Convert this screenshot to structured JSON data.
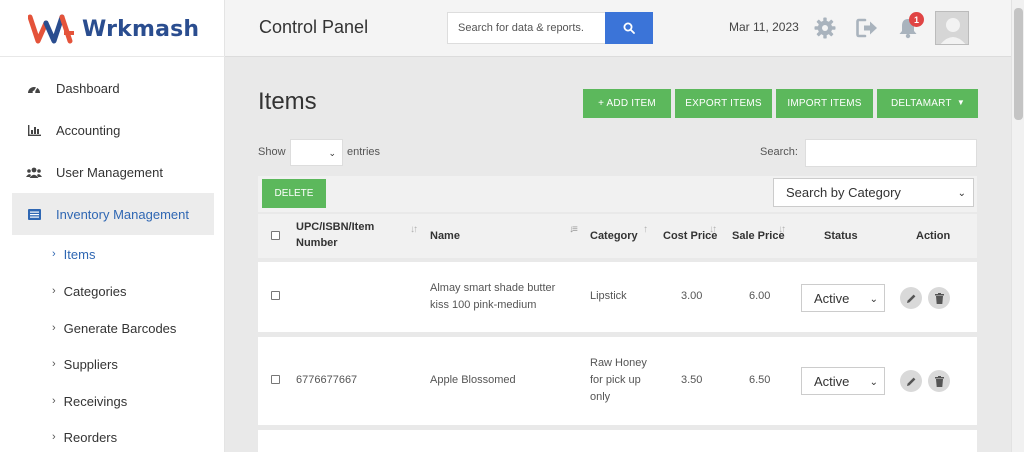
{
  "brand": {
    "name": "Wrkmash"
  },
  "sidebar": {
    "items": [
      {
        "label": "Dashboard",
        "icon": "dashboard-gauge-icon"
      },
      {
        "label": "Accounting",
        "icon": "bar-chart-icon"
      },
      {
        "label": "User Management",
        "icon": "users-icon"
      },
      {
        "label": "Inventory Management",
        "icon": "list-icon",
        "active": true
      }
    ],
    "subitems": [
      {
        "label": "Items",
        "active": true
      },
      {
        "label": "Categories"
      },
      {
        "label": "Generate Barcodes"
      },
      {
        "label": "Suppliers"
      },
      {
        "label": "Receivings"
      },
      {
        "label": "Reorders"
      }
    ]
  },
  "topbar": {
    "title": "Control Panel",
    "search_placeholder": "Search for data & reports.",
    "date": "Mar 11, 2023",
    "notification_count": "1"
  },
  "main": {
    "title": "Items",
    "buttons": {
      "add_item": "+ ADD ITEM",
      "export_items": "EXPORT ITEMS",
      "import_items": "IMPORT ITEMS",
      "store": "DELTAMART"
    },
    "show_label": "Show",
    "entries_label": "entries",
    "search_label": "Search:",
    "delete_label": "DELETE",
    "category_select": "Search by Category"
  },
  "table": {
    "headers": {
      "upc_line1": "UPC/ISBN/Item",
      "upc_line2": "Number",
      "name": "Name",
      "category": "Category",
      "cost_price": "Cost Price",
      "sale_price": "Sale Price",
      "status": "Status",
      "action": "Action"
    },
    "rows": [
      {
        "upc": "",
        "name_line1": "Almay smart shade butter",
        "name_line2": "kiss 100 pink-medium",
        "category_lines": [
          "Lipstick"
        ],
        "cost": "3.00",
        "sale": "6.00",
        "status": "Active"
      },
      {
        "upc": "6776677667",
        "name_line1": "Apple Blossomed",
        "name_line2": "",
        "category_lines": [
          "Raw Honey",
          "for pick up",
          "only"
        ],
        "cost": "3.50",
        "sale": "6.50",
        "status": "Active"
      }
    ]
  },
  "colors": {
    "accent_blue": "#3b74d8",
    "active_nav": "#2f67b3",
    "green_button": "#5cb85c",
    "badge_red": "#e04444",
    "logo_red": "#e4533a",
    "logo_navy": "#2a4d8f"
  }
}
